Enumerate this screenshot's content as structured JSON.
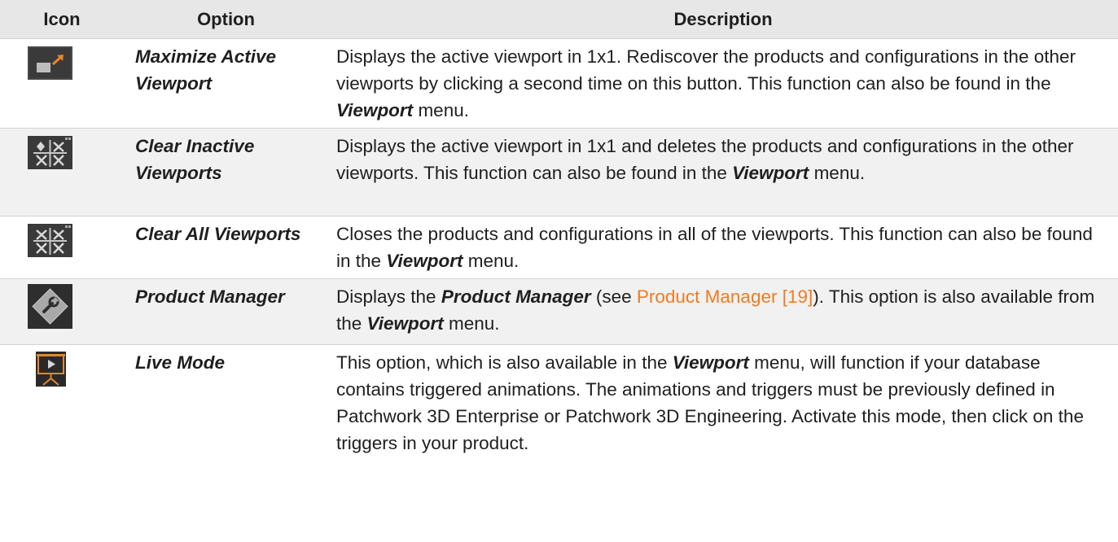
{
  "headers": {
    "icon": "Icon",
    "option": "Option",
    "description": "Description"
  },
  "rows": [
    {
      "icon": "maximize-viewport-icon",
      "option": "Maximize Active Viewport",
      "desc": {
        "t1": "Displays the active viewport in 1x1. Rediscover the products and configurations in the other viewports by clicking a second time on this button. This function can also be found in the ",
        "e1": "Viewport",
        "t2": " menu."
      }
    },
    {
      "icon": "clear-inactive-viewports-icon",
      "option": "Clear Inactive Viewports",
      "desc": {
        "t1": "Displays the active viewport in 1x1 and deletes the products and configurations in the other viewports. This function can also be found in the ",
        "e1": "Viewport",
        "t2": " menu."
      }
    },
    {
      "icon": "clear-all-viewports-icon",
      "option": "Clear All Viewports",
      "desc": {
        "t1": "Closes the products and configurations in all of the viewports. This function can also be found in the ",
        "e1": "Viewport",
        "t2": " menu."
      }
    },
    {
      "icon": "wrench-icon",
      "option": "Product Manager",
      "desc": {
        "t1": "Displays the ",
        "e1": "Product Manager",
        "t2": " (see ",
        "link": "Product Manager [19]",
        "t3": "). This option is also available from the ",
        "e2": "Viewport",
        "t4": " menu."
      }
    },
    {
      "icon": "live-mode-icon",
      "option": "Live Mode",
      "desc": {
        "t1": "This option, which is also available in the ",
        "e1": "Viewport",
        "t2": " menu, will function if your database contains triggered animations. The animations and triggers must be previously defined in Patchwork 3D Enterprise or Patchwork 3D Engineering. Activate this mode, then click on the triggers in your product."
      }
    }
  ],
  "colors": {
    "header_bg": "#e7e7e7",
    "alt_row_bg": "#f1f1f1",
    "link": "#f07b1f",
    "icon_orange": "#e8852a"
  }
}
